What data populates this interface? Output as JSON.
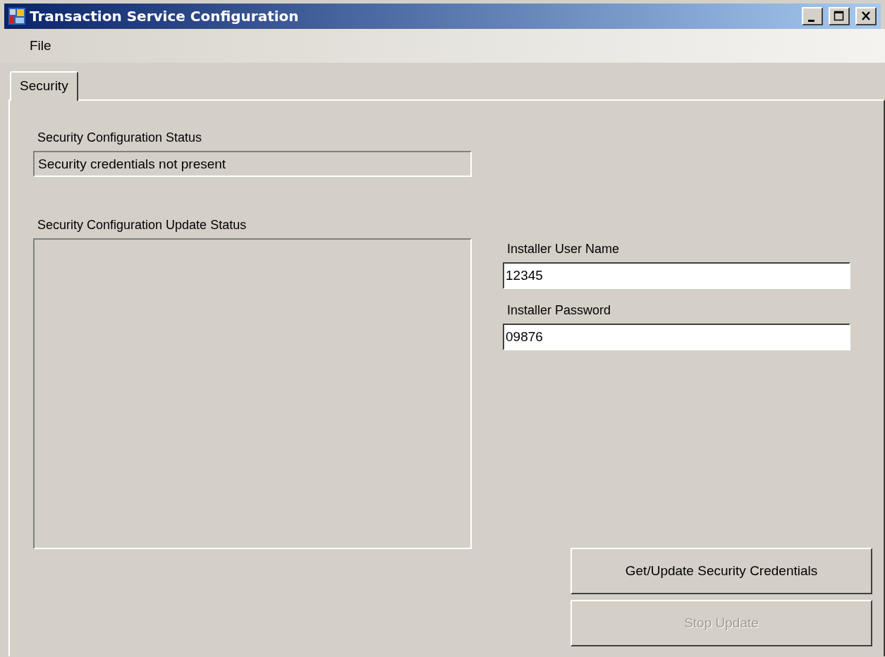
{
  "window": {
    "title": "Transaction Service Configuration"
  },
  "menu": [
    "File"
  ],
  "tabs": [
    {
      "label": "Security",
      "selected": true
    }
  ],
  "config_status": {
    "label": "Security Configuration Status",
    "value": "Security credentials not present"
  },
  "update_status": {
    "label": "Security Configuration Update Status"
  },
  "fields": [
    {
      "label": "Installer User Name",
      "value": "12345"
    },
    {
      "label": "Installer Password",
      "value": "09876"
    }
  ],
  "buttons": [
    {
      "label": "Get/Update Security Credentials",
      "disabled": false
    },
    {
      "label": "Stop Update",
      "disabled": true
    }
  ]
}
